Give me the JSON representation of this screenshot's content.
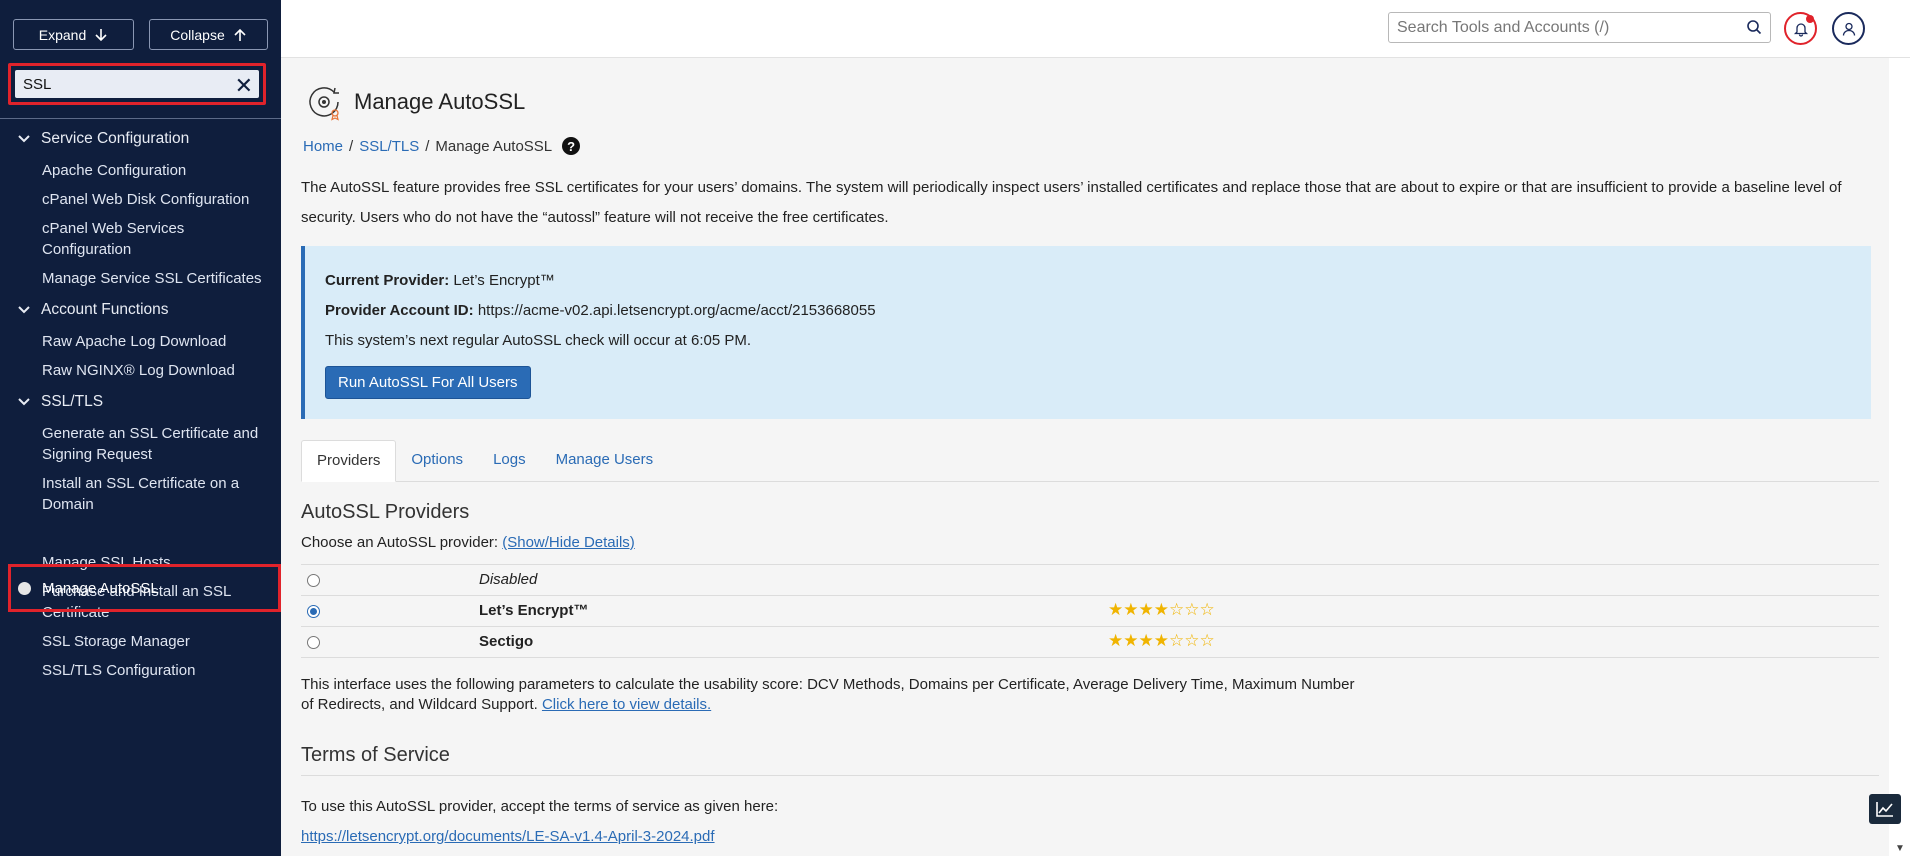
{
  "sidebar": {
    "expand_label": "Expand",
    "collapse_label": "Collapse",
    "search_value": "SSL",
    "groups": [
      {
        "title": "Service Configuration",
        "items": [
          "Apache Configuration",
          "cPanel Web Disk Configuration",
          "cPanel Web Services Configuration",
          "Manage Service SSL Certificates"
        ]
      },
      {
        "title": "Account Functions",
        "items": [
          "Raw Apache Log Download",
          "Raw NGINX® Log Download"
        ]
      },
      {
        "title": "SSL/TLS",
        "items": [
          "Generate an SSL Certificate and Signing Request",
          "Install an SSL Certificate on a Domain",
          "Manage AutoSSL",
          "Manage SSL Hosts",
          "Purchase and Install an SSL Certificate",
          "SSL Storage Manager",
          "SSL/TLS Configuration"
        ]
      }
    ],
    "active_item": "Manage AutoSSL"
  },
  "topbar": {
    "search_placeholder": "Search Tools and Accounts (/)"
  },
  "page": {
    "title": "Manage AutoSSL",
    "breadcrumb": {
      "home": "Home",
      "section": "SSL/TLS",
      "current": "Manage AutoSSL"
    },
    "description": "The AutoSSL feature provides free SSL certificates for your users’ domains. The system will periodically inspect users’ installed certificates and replace those that are about to expire or that are insufficient to provide a baseline level of security. Users who do not have the “autossl” feature will not receive the free certificates.",
    "info": {
      "provider_label": "Current Provider:",
      "provider_value": "Let’s Encrypt™",
      "account_label": "Provider Account ID:",
      "account_value": "https://acme-v02.api.letsencrypt.org/acme/acct/2153668055",
      "next_check": "This system’s next regular AutoSSL check will occur at 6:05 PM.",
      "run_button": "Run AutoSSL For All Users"
    },
    "tabs": [
      "Providers",
      "Options",
      "Logs",
      "Manage Users"
    ],
    "active_tab": "Providers",
    "providers": {
      "title": "AutoSSL Providers",
      "choose_label": "Choose an AutoSSL provider:",
      "toggle_details": "(Show/Hide Details)",
      "rows": [
        {
          "name": "Disabled",
          "selected": false,
          "rating": null
        },
        {
          "name": "Let’s Encrypt™",
          "selected": true,
          "rating": 4
        },
        {
          "name": "Sectigo",
          "selected": false,
          "rating": 4
        }
      ],
      "rating_max": 7
    },
    "usability_text": "This interface uses the following parameters to calculate the usability score: DCV Methods, Domains per Certificate, Average Delivery Time, Maximum Number of Redirects, and Wildcard Support.",
    "usability_link": "Click here to view details.",
    "tos": {
      "title": "Terms of Service",
      "text": "To use this AutoSSL provider, accept the terms of service as given here:",
      "link": "https://letsencrypt.org/documents/LE-SA-v1.4-April-3-2024.pdf"
    }
  },
  "colors": {
    "sidebar_bg": "#0f1e3d",
    "accent": "#2a6bb5",
    "highlight": "#e0232b",
    "info_bg": "#d9ecf8",
    "star": "#f0b400"
  }
}
